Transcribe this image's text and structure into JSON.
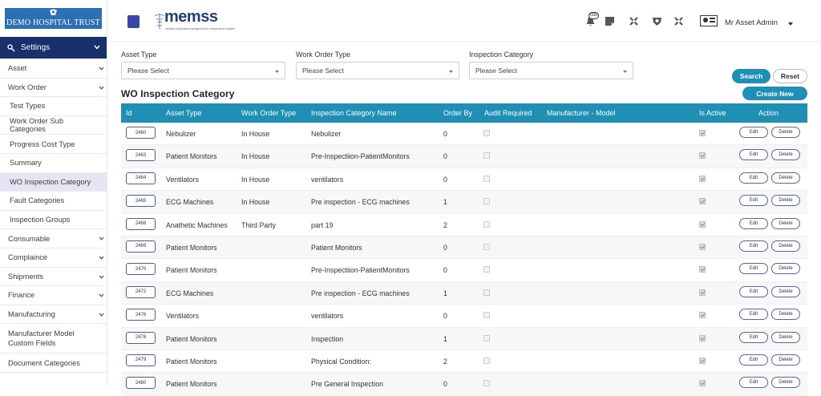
{
  "brand": {
    "name": "DEMO HOSPITAL TRUST"
  },
  "sidebar": {
    "settings_label": "Settings",
    "items": [
      {
        "label": "Asset",
        "expandable": true,
        "sub": false
      },
      {
        "label": "Work Order",
        "expandable": true,
        "sub": false
      },
      {
        "label": "Test Types",
        "expandable": false,
        "sub": true
      },
      {
        "label": "Work Order Sub Categories",
        "expandable": false,
        "sub": true
      },
      {
        "label": "Progress Cost Type",
        "expandable": false,
        "sub": true
      },
      {
        "label": "Summary",
        "expandable": false,
        "sub": true
      },
      {
        "label": "WO Inspection Category",
        "expandable": false,
        "sub": true,
        "active": true
      },
      {
        "label": "Fault Categories",
        "expandable": false,
        "sub": true
      },
      {
        "label": "Inspection Groups",
        "expandable": false,
        "sub": true
      },
      {
        "label": "Consumable",
        "expandable": true,
        "sub": false
      },
      {
        "label": "Complaince",
        "expandable": true,
        "sub": false
      },
      {
        "label": "Shipments",
        "expandable": true,
        "sub": false
      },
      {
        "label": "Finance",
        "expandable": true,
        "sub": false
      },
      {
        "label": "Manufacturing",
        "expandable": true,
        "sub": false
      },
      {
        "label": "Manufacturer Model Custom Fields",
        "expandable": false,
        "sub": false,
        "two": true
      },
      {
        "label": "Document Categories",
        "expandable": false,
        "sub": false
      }
    ]
  },
  "header": {
    "logo_text": "memss",
    "logo_tagline": "medical equipment management & maintenance system",
    "notification_count": "688",
    "user_name": "Mr Asset Admin"
  },
  "filters": {
    "asset_type": {
      "label": "Asset Type",
      "value": "Please Select"
    },
    "work_order_type": {
      "label": "Work Order Type",
      "value": "Please Select"
    },
    "inspection_category": {
      "label": "Inspection Category",
      "value": "Please Select"
    }
  },
  "buttons": {
    "search": "Search",
    "reset": "Reset",
    "create": "Create New",
    "edit": "Edit",
    "delete": "Delete"
  },
  "page_title": "WO Inspection Category",
  "table": {
    "columns": [
      "Id",
      "Asset Type",
      "Work Order Type",
      "Inspection Category Name",
      "Order By",
      "Audit Required",
      "Manufacturer - Model",
      "Is Active",
      "Action"
    ],
    "rows": [
      {
        "id": "2460",
        "asset_type": "Nebulizer",
        "wo_type": "In House",
        "name": "Nebulizer",
        "order_by": "0",
        "audit": false,
        "active": true
      },
      {
        "id": "2463",
        "asset_type": "Patient Monitors",
        "wo_type": "In House",
        "name": "Pre-Inspectiion-PatientMonitors",
        "order_by": "0",
        "audit": false,
        "active": true
      },
      {
        "id": "2464",
        "asset_type": "Ventilators",
        "wo_type": "In House",
        "name": "ventilators",
        "order_by": "0",
        "audit": false,
        "active": true
      },
      {
        "id": "2465",
        "asset_type": "ECG Machines",
        "wo_type": "In House",
        "name": "Pre inspection - ECG machines",
        "order_by": "1",
        "audit": false,
        "active": true
      },
      {
        "id": "2468",
        "asset_type": "Anathetic Machines",
        "wo_type": "Third Party",
        "name": "part 19",
        "order_by": "2",
        "audit": false,
        "active": true
      },
      {
        "id": "2469",
        "asset_type": "Patient Monitors",
        "wo_type": "",
        "name": "Patient Monitors",
        "order_by": "0",
        "audit": false,
        "active": true
      },
      {
        "id": "2470",
        "asset_type": "Patient Monitors",
        "wo_type": "",
        "name": "Pre-Inspectiion-PatientMonitors",
        "order_by": "0",
        "audit": false,
        "active": true
      },
      {
        "id": "2472",
        "asset_type": "ECG Machines",
        "wo_type": "",
        "name": "Pre inspection - ECG machines",
        "order_by": "1",
        "audit": false,
        "active": true
      },
      {
        "id": "2476",
        "asset_type": "Ventilators",
        "wo_type": "",
        "name": "ventilators",
        "order_by": "0",
        "audit": false,
        "active": true
      },
      {
        "id": "2478",
        "asset_type": "Patient Monitors",
        "wo_type": "",
        "name": "Inspection",
        "order_by": "1",
        "audit": false,
        "active": true
      },
      {
        "id": "2479",
        "asset_type": "Patient Monitors",
        "wo_type": "",
        "name": "Physical Condition:",
        "order_by": "2",
        "audit": false,
        "active": true
      },
      {
        "id": "2480",
        "asset_type": "Patient Monitors",
        "wo_type": "",
        "name": "Pre General Inspection",
        "order_by": "0",
        "audit": false,
        "active": true
      }
    ]
  }
}
